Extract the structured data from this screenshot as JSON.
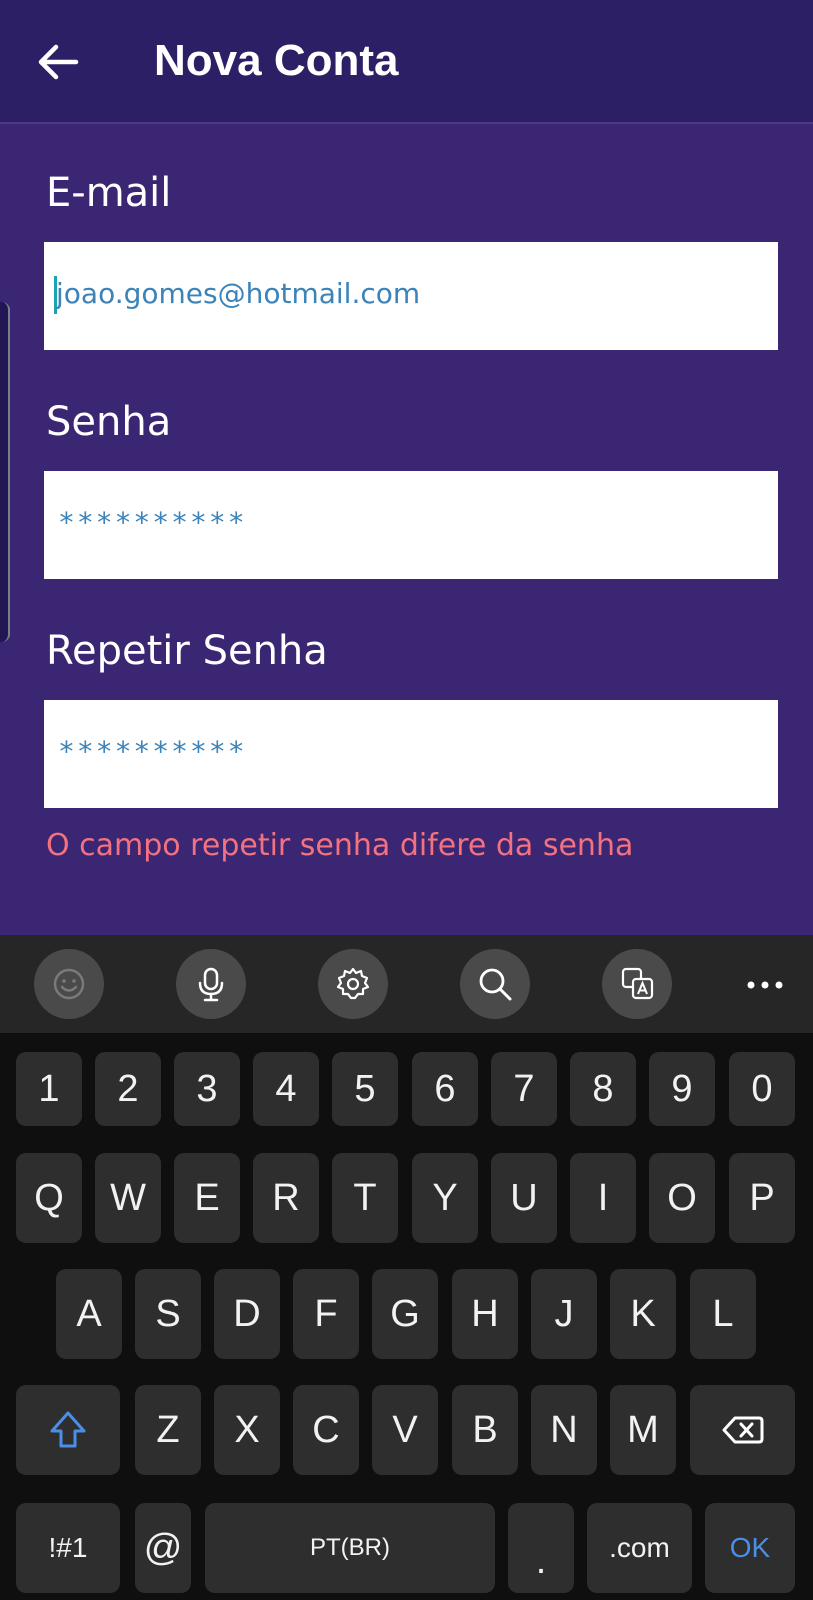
{
  "appbar": {
    "title": "Nova Conta",
    "back_icon": "arrow-left-icon"
  },
  "form": {
    "email": {
      "label": "E-mail",
      "value": "joao.gomes@hotmail.com"
    },
    "password": {
      "label": "Senha",
      "value": "**********"
    },
    "repeat_password": {
      "label": "Repetir Senha",
      "value": "**********",
      "error": "O campo repetir senha difere da senha"
    }
  },
  "colors": {
    "background": "#3a2672",
    "appbar": "#2c1f66",
    "input_text": "#3b83b8",
    "error": "#f4717f",
    "keyboard": "#0f0f0f",
    "key": "#2e2e2e",
    "accent": "#4a8ee8"
  },
  "keyboard": {
    "toolbar_icons": [
      "emoji-icon",
      "microphone-icon",
      "settings-icon",
      "search-icon",
      "translate-icon",
      "more-icon"
    ],
    "row_numbers": [
      "1",
      "2",
      "3",
      "4",
      "5",
      "6",
      "7",
      "8",
      "9",
      "0"
    ],
    "row_top": [
      "Q",
      "W",
      "E",
      "R",
      "T",
      "Y",
      "U",
      "I",
      "O",
      "P"
    ],
    "row_middle": [
      "A",
      "S",
      "D",
      "F",
      "G",
      "H",
      "J",
      "K",
      "L"
    ],
    "row_bottom": [
      "Z",
      "X",
      "C",
      "V",
      "B",
      "N",
      "M"
    ],
    "symbols_label": "!#1",
    "at_label": "@",
    "space_label": "PT(BR)",
    "period_label": ".",
    "dotcom_label": ".com",
    "ok_label": "OK"
  }
}
